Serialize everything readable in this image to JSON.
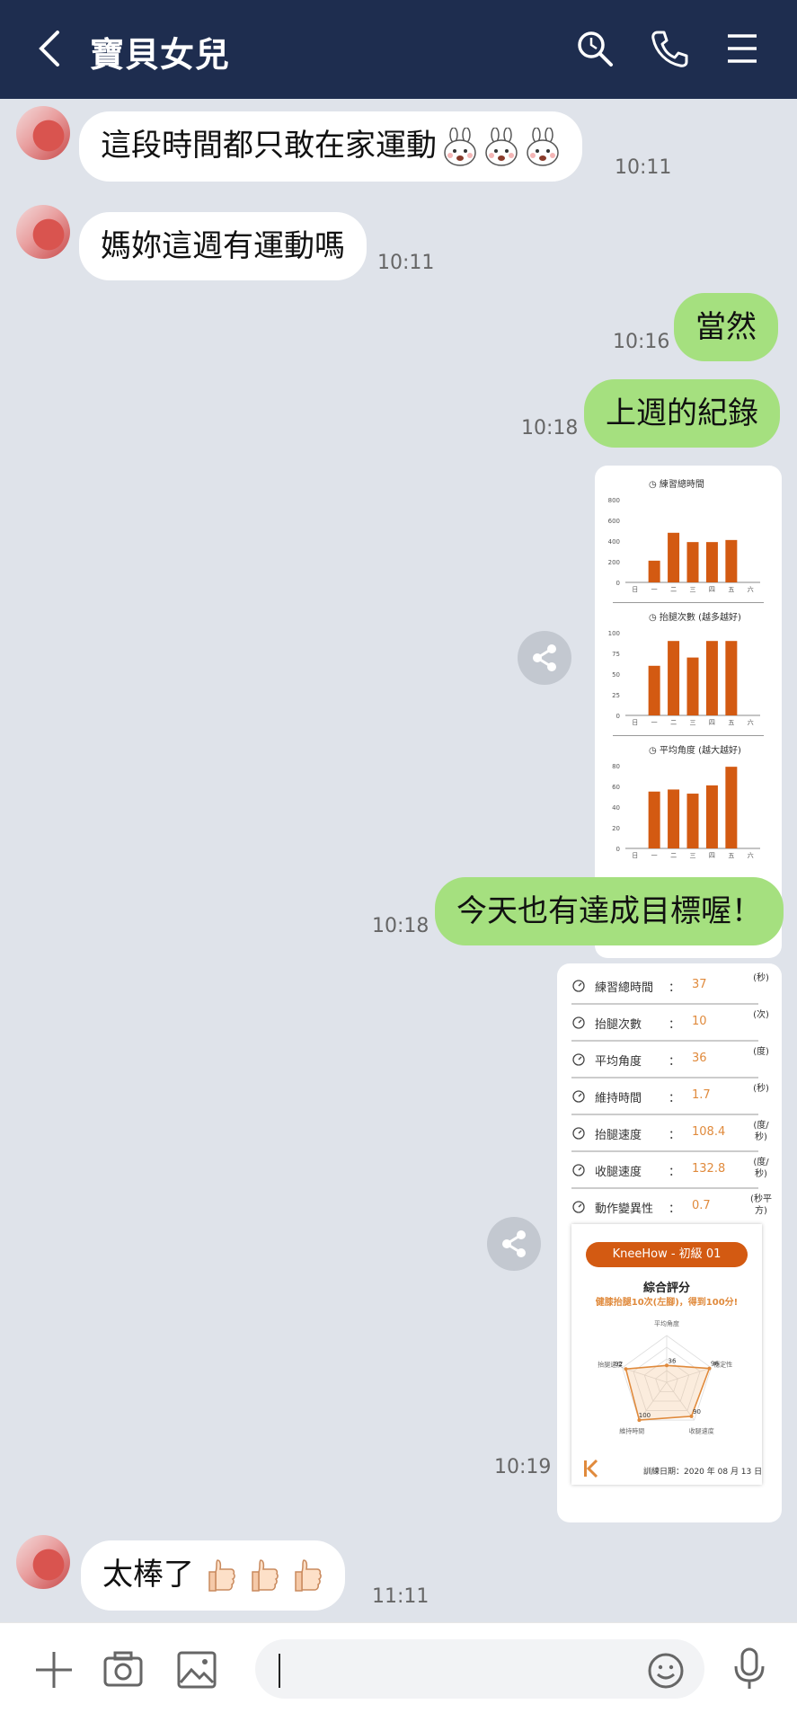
{
  "header": {
    "title": "寶貝女兒",
    "icons": [
      "back-icon",
      "search-icon",
      "phone-icon",
      "menu-icon"
    ]
  },
  "messages": [
    {
      "side": "in",
      "text": "這段時間都只敢在家運動",
      "emoji": "bunny-sticker x3",
      "time": "10:11"
    },
    {
      "side": "in",
      "text": "媽妳這週有運動嗎",
      "time": "10:11"
    },
    {
      "side": "out",
      "text": "當然",
      "time": "10:16"
    },
    {
      "side": "out",
      "text": "上週的紀錄",
      "time": "10:18"
    },
    {
      "side": "out",
      "text": "今天也有達成目標喔！",
      "time": "10:18"
    },
    {
      "side": "out",
      "time": "10:19"
    },
    {
      "side": "in",
      "text": "太棒了",
      "emoji": "thumbs-up x3",
      "time": "11:11"
    }
  ],
  "weekly_image": {
    "days": [
      "日",
      "一",
      "二",
      "三",
      "四",
      "五",
      "六"
    ],
    "charts": [
      {
        "title": "練習總時間",
        "yticks": [
          "0",
          "200",
          "400",
          "600",
          "800"
        ],
        "ymax": 800,
        "values": [
          0,
          210,
          480,
          390,
          390,
          410,
          0
        ]
      },
      {
        "title": "抬腿次數 (越多越好)",
        "yticks": [
          "0",
          "25",
          "50",
          "75",
          "100"
        ],
        "ymax": 100,
        "values": [
          0,
          60,
          90,
          70,
          90,
          90,
          0
        ]
      },
      {
        "title": "平均角度 (越大越好)",
        "yticks": [
          "0",
          "20",
          "40",
          "60",
          "80"
        ],
        "ymax": 80,
        "values": [
          0,
          55,
          57,
          53,
          61,
          79,
          0
        ]
      }
    ]
  },
  "today_image": {
    "stats": [
      {
        "label": "練習總時間",
        "value": "37",
        "unit": "(秒)"
      },
      {
        "label": "抬腿次數",
        "value": "10",
        "unit": "(次)"
      },
      {
        "label": "平均角度",
        "value": "36",
        "unit": "(度)"
      },
      {
        "label": "維持時間",
        "value": "1.7",
        "unit": "(秒)"
      },
      {
        "label": "抬腿速度",
        "value": "108.4",
        "unit": "(度/秒)"
      },
      {
        "label": "收腿速度",
        "value": "132.8",
        "unit": "(度/秒)"
      },
      {
        "label": "動作變異性",
        "value": "0.7",
        "unit": "(秒平方)"
      }
    ],
    "score_card": {
      "badge": "KneeHow - 初級 01",
      "heading": "綜合評分",
      "subtitle": "健膝抬腿10次(左腳)，得到100分!",
      "radar_axes": [
        "平均角度",
        "穩定性",
        "收腿速度",
        "維持時間",
        "抬腿速度"
      ],
      "radar_values": [
        "36",
        "96",
        "90",
        "100",
        "92"
      ],
      "date": "訓練日期：2020 年 08 月 13 日"
    }
  },
  "footer": {
    "icons": [
      "plus-icon",
      "camera-icon",
      "image-icon",
      "emoji-icon",
      "microphone-icon"
    ]
  },
  "colors": {
    "header": "#1e2d4f",
    "out_bubble": "#a5e07f",
    "bar": "#d35a12",
    "value": "#e08a3c"
  }
}
